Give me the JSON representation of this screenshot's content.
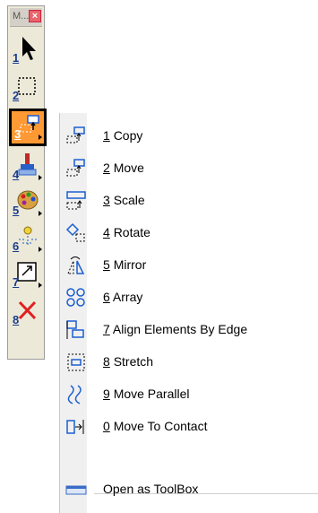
{
  "toolbox": {
    "title": "M...",
    "close": "×",
    "buttons": [
      {
        "num": "1"
      },
      {
        "num": "2"
      },
      {
        "num": "3"
      },
      {
        "num": "4"
      },
      {
        "num": "5"
      },
      {
        "num": "6"
      },
      {
        "num": "7"
      },
      {
        "num": "8"
      }
    ]
  },
  "menu": {
    "items": [
      {
        "key": "1",
        "label": "Copy"
      },
      {
        "key": "2",
        "label": "Move"
      },
      {
        "key": "3",
        "label": "Scale"
      },
      {
        "key": "4",
        "label": "Rotate"
      },
      {
        "key": "5",
        "label": "Mirror"
      },
      {
        "key": "6",
        "label": "Array"
      },
      {
        "key": "7",
        "label": "Align Elements By Edge"
      },
      {
        "key": "8",
        "label": "Stretch"
      },
      {
        "key": "9",
        "label": "Move Parallel"
      },
      {
        "key": "0",
        "label": "Move To Contact"
      }
    ],
    "open_toolbox": "Open as ToolBox"
  },
  "colors": {
    "active_button": "#ff9933",
    "icon_blue": "#1a5fd1",
    "delete_red": "#e02020"
  }
}
